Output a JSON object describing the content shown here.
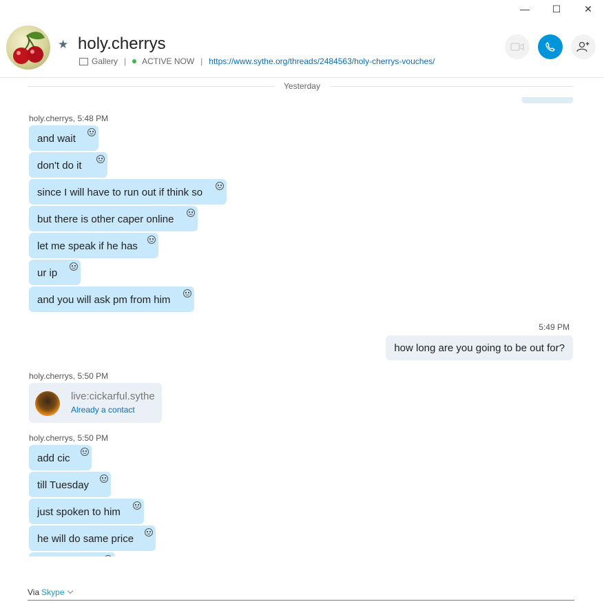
{
  "window": {
    "minimize": "—",
    "maximize": "☐",
    "close": "✕"
  },
  "header": {
    "contact_name": "holy.cherrys",
    "gallery": "Gallery",
    "status": "ACTIVE NOW",
    "link": "https://www.sythe.org/threads/2484563/holy-cherrys-vouches/",
    "status_color": "#39b54a",
    "accent": "#0094d9"
  },
  "chat": {
    "day_divider": "Yesterday",
    "groups": [
      {
        "sender": "holy.cherrys, 5:48 PM",
        "messages": [
          "and wait",
          "don't do it",
          "since I will have to run out if think so",
          "but there is other caper online",
          "let me speak if he has",
          "ur ip",
          "and you will ask pm from him"
        ]
      },
      {
        "sender": "holy.cherrys, 5:50 PM",
        "messages": [
          "add cic",
          "till Tuesday",
          "just spoken to him",
          "he will do same price"
        ]
      }
    ],
    "outgoing": {
      "time": "5:49 PM",
      "text": "how long are you going to be out for?"
    },
    "contact_card": {
      "sender": "holy.cherrys, 5:50 PM",
      "name": "live:cickarful.sythe",
      "status": "Already a contact"
    }
  },
  "compose": {
    "via": "Via",
    "service": "Skype"
  }
}
